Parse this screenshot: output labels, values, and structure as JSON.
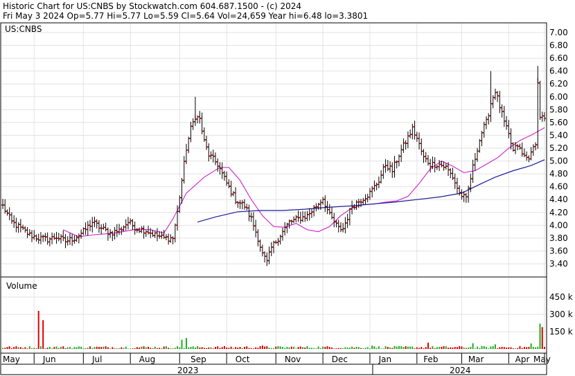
{
  "header": {
    "line1": "Historic Chart for US:CNBS by Stockwatch.com 604.687.1500 - (c) 2024",
    "line2": "Fri May  3 2024  Op=5.77  Hi=5.77  Lo=5.59  Cl=5.64  Vol=24,659  Year hi=6.48  lo=3.3801"
  },
  "chart_data": [
    {
      "type": "line",
      "subtype": "ohlc-price",
      "symbol_label": "US:CNBS",
      "title": "",
      "ylim": [
        3.2,
        7.1
      ],
      "y_ticks": [
        "7.00",
        "6.80",
        "6.60",
        "6.40",
        "6.20",
        "6.00",
        "5.80",
        "5.60",
        "5.40",
        "5.20",
        "5.00",
        "4.80",
        "4.60",
        "4.40",
        "4.20",
        "4.00",
        "3.80",
        "3.60",
        "3.40"
      ],
      "x_month_labels": [
        "May",
        "Jun",
        "Jul",
        "Aug",
        "Sep",
        "Oct",
        "Nov",
        "Dec",
        "Jan",
        "Feb",
        "Mar",
        "Apr",
        "May"
      ],
      "x_year_labels": [
        "2023",
        "2024"
      ],
      "grid": true,
      "price_color": "#8b0000",
      "ma_short_color": "#cc33cc",
      "ma_long_color": "#1a1a99",
      "anchors": [
        [
          0,
          4.3
        ],
        [
          4,
          4.05
        ],
        [
          8,
          3.95
        ],
        [
          12,
          3.85
        ],
        [
          16,
          3.8
        ],
        [
          20,
          3.78
        ],
        [
          24,
          3.82
        ],
        [
          28,
          3.75
        ],
        [
          32,
          3.8
        ],
        [
          36,
          3.9
        ],
        [
          40,
          4.05
        ],
        [
          44,
          3.95
        ],
        [
          48,
          3.88
        ],
        [
          52,
          3.92
        ],
        [
          56,
          4.05
        ],
        [
          60,
          3.95
        ],
        [
          64,
          3.92
        ],
        [
          68,
          3.85
        ],
        [
          72,
          3.8
        ],
        [
          76,
          3.8
        ],
        [
          78,
          4.2
        ],
        [
          80,
          4.7
        ],
        [
          82,
          5.2
        ],
        [
          84,
          5.5
        ],
        [
          86,
          5.7
        ],
        [
          88,
          5.65
        ],
        [
          90,
          5.3
        ],
        [
          92,
          5.1
        ],
        [
          96,
          4.95
        ],
        [
          100,
          4.65
        ],
        [
          104,
          4.4
        ],
        [
          108,
          4.3
        ],
        [
          111,
          4.1
        ],
        [
          114,
          3.8
        ],
        [
          116,
          3.55
        ],
        [
          118,
          3.42
        ],
        [
          120,
          3.65
        ],
        [
          124,
          3.85
        ],
        [
          128,
          4.05
        ],
        [
          132,
          4.1
        ],
        [
          136,
          4.15
        ],
        [
          140,
          4.3
        ],
        [
          143,
          4.42
        ],
        [
          146,
          4.15
        ],
        [
          150,
          3.95
        ],
        [
          152,
          3.95
        ],
        [
          156,
          4.3
        ],
        [
          160,
          4.4
        ],
        [
          164,
          4.5
        ],
        [
          168,
          4.7
        ],
        [
          171,
          4.95
        ],
        [
          174,
          4.85
        ],
        [
          177,
          5.1
        ],
        [
          180,
          5.3
        ],
        [
          183,
          5.5
        ],
        [
          185,
          5.35
        ],
        [
          188,
          5.05
        ],
        [
          191,
          4.95
        ],
        [
          195,
          4.95
        ],
        [
          198,
          4.9
        ],
        [
          201,
          4.75
        ],
        [
          204,
          4.5
        ],
        [
          207,
          4.4
        ],
        [
          210,
          4.9
        ],
        [
          212,
          5.2
        ],
        [
          214,
          5.45
        ],
        [
          216,
          5.6
        ],
        [
          218,
          5.9
        ],
        [
          220,
          6.1
        ],
        [
          222,
          5.85
        ],
        [
          224,
          5.6
        ],
        [
          226,
          5.4
        ],
        [
          228,
          5.15
        ],
        [
          230,
          5.25
        ],
        [
          232,
          5.1
        ],
        [
          234,
          5.05
        ],
        [
          236,
          5.1
        ],
        [
          238,
          5.3
        ],
        [
          239,
          6.2
        ],
        [
          240,
          5.7
        ],
        [
          242,
          5.64
        ]
      ],
      "ma_short": [
        [
          27,
          3.93
        ],
        [
          34,
          3.82
        ],
        [
          40,
          3.85
        ],
        [
          50,
          3.88
        ],
        [
          60,
          3.94
        ],
        [
          66,
          3.93
        ],
        [
          72,
          3.88
        ],
        [
          76,
          4.1
        ],
        [
          82,
          4.5
        ],
        [
          90,
          4.75
        ],
        [
          97,
          4.9
        ],
        [
          101,
          4.9
        ],
        [
          106,
          4.7
        ],
        [
          111,
          4.4
        ],
        [
          116,
          4.15
        ],
        [
          121,
          3.98
        ],
        [
          126,
          3.97
        ],
        [
          131,
          4.03
        ],
        [
          136,
          3.93
        ],
        [
          141,
          3.9
        ],
        [
          146,
          3.98
        ],
        [
          151,
          4.15
        ],
        [
          156,
          4.27
        ],
        [
          161,
          4.32
        ],
        [
          166,
          4.33
        ],
        [
          171,
          4.36
        ],
        [
          176,
          4.38
        ],
        [
          181,
          4.45
        ],
        [
          186,
          4.65
        ],
        [
          191,
          4.88
        ],
        [
          196,
          5.0
        ],
        [
          201,
          4.92
        ],
        [
          206,
          4.82
        ],
        [
          211,
          4.85
        ],
        [
          216,
          4.95
        ],
        [
          221,
          5.05
        ],
        [
          226,
          5.2
        ],
        [
          231,
          5.32
        ],
        [
          237,
          5.42
        ],
        [
          242,
          5.52
        ]
      ],
      "ma_long": [
        [
          87,
          4.05
        ],
        [
          95,
          4.13
        ],
        [
          105,
          4.21
        ],
        [
          115,
          4.23
        ],
        [
          125,
          4.23
        ],
        [
          135,
          4.25
        ],
        [
          145,
          4.28
        ],
        [
          155,
          4.3
        ],
        [
          165,
          4.33
        ],
        [
          175,
          4.36
        ],
        [
          185,
          4.4
        ],
        [
          195,
          4.44
        ],
        [
          205,
          4.5
        ],
        [
          212,
          4.62
        ],
        [
          220,
          4.75
        ],
        [
          228,
          4.85
        ],
        [
          236,
          4.93
        ],
        [
          242,
          5.02
        ]
      ]
    },
    {
      "type": "bar",
      "title": "Volume",
      "y_ticks": [
        "450 k",
        "300 k",
        "150 k"
      ],
      "ylim": [
        0,
        560000
      ],
      "up_color": "#22aa22",
      "down_color": "#dd0000",
      "spikes": [
        [
          16,
          330000,
          "down"
        ],
        [
          18,
          250000,
          "down"
        ],
        [
          80,
          80000,
          "up"
        ],
        [
          82,
          95000,
          "up"
        ],
        [
          116,
          30000,
          "down"
        ],
        [
          165,
          30000,
          "up"
        ],
        [
          190,
          55000,
          "down"
        ],
        [
          210,
          50000,
          "up"
        ],
        [
          220,
          40000,
          "up"
        ],
        [
          236,
          48000,
          "up"
        ],
        [
          240,
          220000,
          "up"
        ],
        [
          241,
          190000,
          "down"
        ]
      ]
    }
  ]
}
